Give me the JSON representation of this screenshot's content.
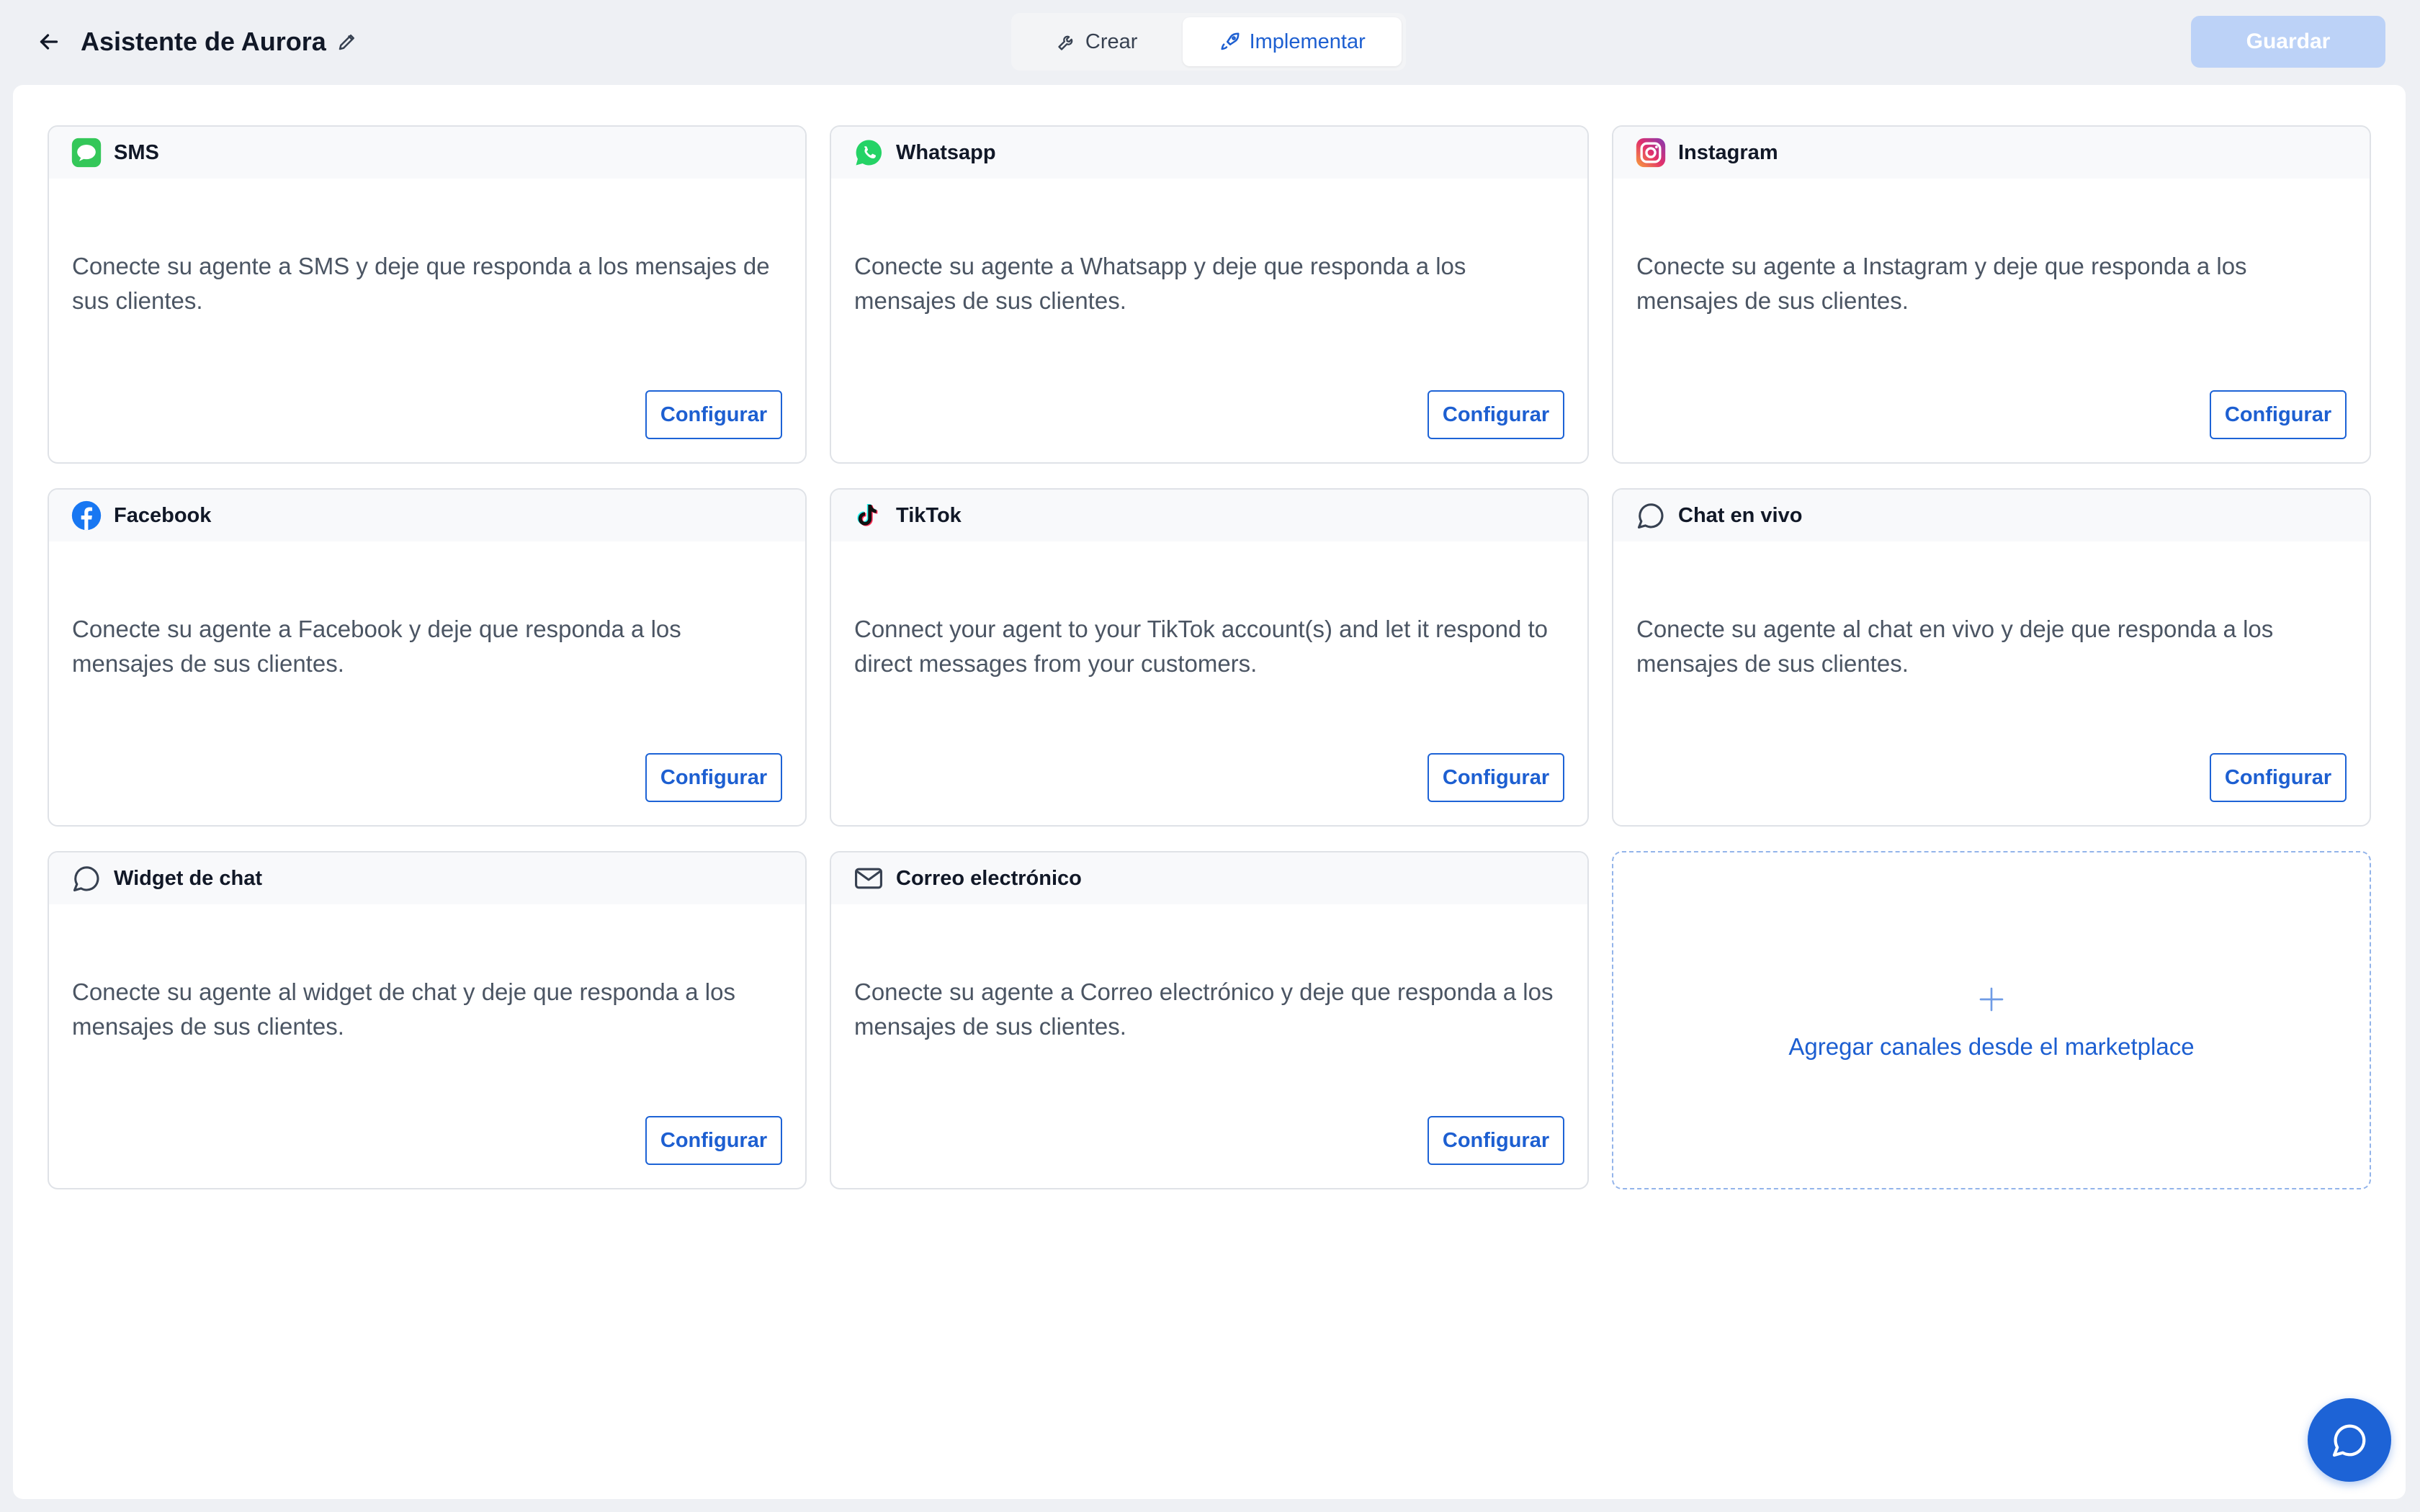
{
  "header": {
    "title": "Asistente de Aurora",
    "back_icon": "arrow-left-icon",
    "edit_icon": "pencil-icon",
    "tabs": [
      {
        "label": "Crear",
        "icon": "wrench-icon",
        "active": false
      },
      {
        "label": "Implementar",
        "icon": "rocket-icon",
        "active": true
      }
    ],
    "save_label": "Guardar"
  },
  "channels": [
    {
      "name": "SMS",
      "icon": "sms-icon",
      "description": "Conecte su agente a SMS y deje que responda a los mensajes de sus clientes.",
      "button": "Configurar"
    },
    {
      "name": "Whatsapp",
      "icon": "whatsapp-icon",
      "description": "Conecte su agente a Whatsapp y deje que responda a los mensajes de sus clientes.",
      "button": "Configurar"
    },
    {
      "name": "Instagram",
      "icon": "instagram-icon",
      "description": "Conecte su agente a Instagram y deje que responda a los mensajes de sus clientes.",
      "button": "Configurar"
    },
    {
      "name": "Facebook",
      "icon": "facebook-icon",
      "description": "Conecte su agente a Facebook y deje que responda a los mensajes de sus clientes.",
      "button": "Configurar"
    },
    {
      "name": "TikTok",
      "icon": "tiktok-icon",
      "description": "Connect your agent to your TikTok account(s) and let it respond to direct messages from your customers.",
      "button": "Configurar"
    },
    {
      "name": "Chat en vivo",
      "icon": "chat-bubble-icon",
      "description": "Conecte su agente al chat en vivo y deje que responda a los mensajes de sus clientes.",
      "button": "Configurar"
    },
    {
      "name": "Widget de chat",
      "icon": "chat-bubble-icon",
      "description": "Conecte su agente al widget de chat y deje que responda a los mensajes de sus clientes.",
      "button": "Configurar"
    },
    {
      "name": "Correo electrónico",
      "icon": "mail-icon",
      "description": "Conecte su agente a Correo electrónico y deje que responda a los mensajes de sus clientes.",
      "button": "Configurar"
    }
  ],
  "marketplace": {
    "label": "Agregar canales desde el marketplace",
    "icon": "plus-icon"
  },
  "fab": {
    "icon": "chat-bubble-icon"
  },
  "colors": {
    "accent": "#1d63d6",
    "save_disabled": "#bcd2f7",
    "background": "#eef0f4",
    "sms": "#34c759",
    "whatsapp": "#25d366",
    "facebook": "#1877f2",
    "instagram": "#e1306c"
  }
}
